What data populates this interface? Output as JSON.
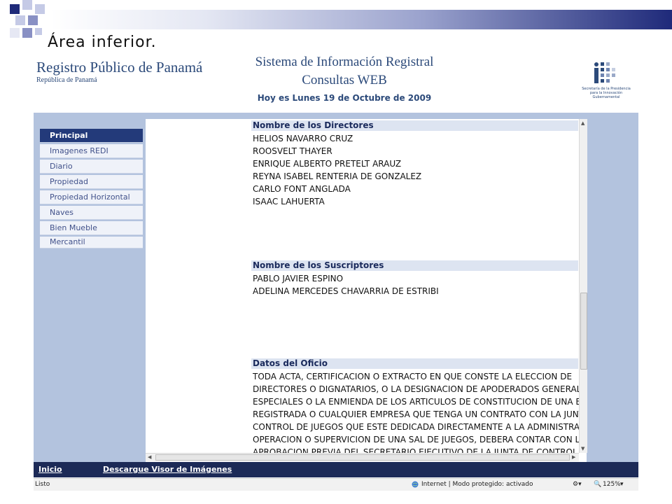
{
  "slide": {
    "title": "Área inferior."
  },
  "header": {
    "registry_title": "Registro Público de Panamá",
    "registry_subtitle": "República de Panamá",
    "system_title_line1": "Sistema de Información Registral",
    "system_title_line2": "Consultas WEB",
    "date_text": "Hoy es Lunes 19 de Octubre de 2009",
    "logo_caption": "Secretaría de la Presidencia para la Innovación Gubernamental"
  },
  "menu": {
    "items": [
      {
        "label": "Principal",
        "active": true
      },
      {
        "label": "Imagenes REDI",
        "active": false
      },
      {
        "label": "Diario",
        "active": false
      },
      {
        "label": "Propiedad",
        "active": false
      },
      {
        "label": "Propiedad Horizontal",
        "active": false
      },
      {
        "label": "Naves",
        "active": false
      },
      {
        "label": "Bien Mueble",
        "active": false
      },
      {
        "label": "Mercantil",
        "active": false
      }
    ]
  },
  "sections": {
    "directors": {
      "heading": "Nombre de los Directores",
      "names": [
        "HELIOS NAVARRO CRUZ",
        "ROOSVELT THAYER",
        "ENRIQUE ALBERTO PRETELT ARAUZ",
        "REYNA ISABEL RENTERIA DE GONZALEZ",
        "CARLO FONT ANGLADA",
        "ISAAC LAHUERTA"
      ]
    },
    "subscribers": {
      "heading": "Nombre de los Suscriptores",
      "names": [
        "PABLO JAVIER ESPINO",
        "ADELINA MERCEDES CHAVARRIA DE ESTRIBI"
      ]
    },
    "office": {
      "heading": "Datos del Oficio",
      "lines": [
        "TODA ACTA, CERTIFICACION O EXTRACTO EN QUE CONSTE LA ELECCION DE",
        "DIRECTORES O DIGNATARIOS, O LA DESIGNACION DE APODERADOS GENERALES O",
        "ESPECIALES O LA ENMIENDA DE LOS ARTICULOS DE CONSTITUCION DE UNA EMPRE",
        "REGISTRADA O CUALQUIER EMPRESA QUE TENGA UN CONTRATO CON LA JUNTA DE",
        "CONTROL DE JUEGOS QUE ESTE DEDICADA DIRECTAMENTE A LA ADMINISTRACION",
        "OPERACION O SUPERVICION DE UNA SAL DE JUEGOS, DEBERA CONTAR CON LA",
        "APROBACION PREVIA DEL SECRETARIO EJECUTIVO DE LA JUNTA DE CONTROL DE"
      ]
    }
  },
  "footer": {
    "home_link": "Inicio",
    "download_link": "Descargue Visor de Imágenes"
  },
  "statusbar": {
    "left": "Listo",
    "zone": "Internet | Modo protegido: activado",
    "zoom": "125%"
  },
  "colors": {
    "frame": "#b3c3de",
    "menu_active": "#233a7a",
    "footer": "#1c2a57",
    "heading": "#2c4a7a"
  }
}
